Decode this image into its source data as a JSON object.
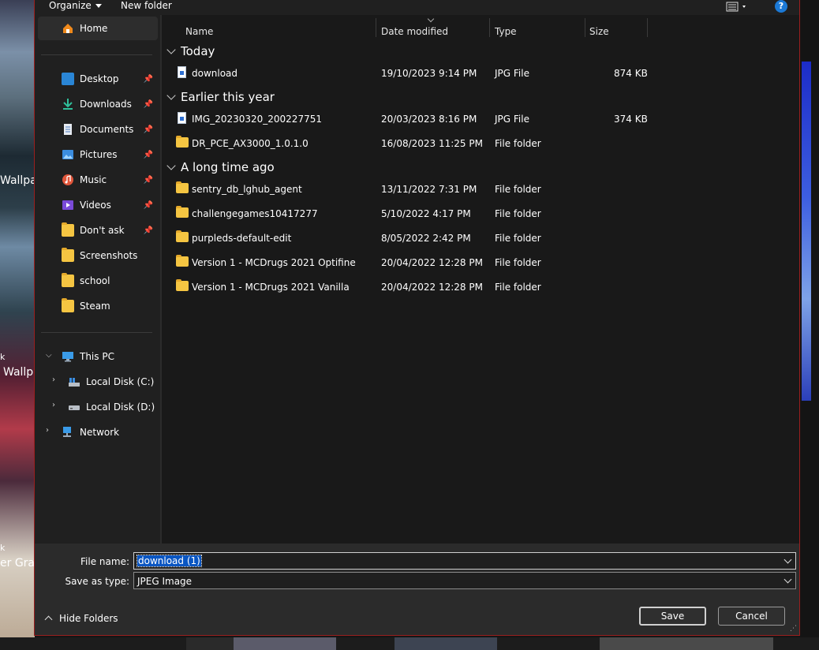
{
  "background": {
    "left_texts": [
      "Wallpap",
      "k",
      "Wallpa",
      "k",
      "er Grap"
    ]
  },
  "toolbar": {
    "organize": "Organize",
    "new_folder": "New folder",
    "help": "?"
  },
  "nav": {
    "home": "Home",
    "quick": [
      {
        "label": "Desktop",
        "pinned": true
      },
      {
        "label": "Downloads",
        "pinned": true
      },
      {
        "label": "Documents",
        "pinned": true
      },
      {
        "label": "Pictures",
        "pinned": true
      },
      {
        "label": "Music",
        "pinned": true
      },
      {
        "label": "Videos",
        "pinned": true
      },
      {
        "label": "Don't ask",
        "pinned": true
      },
      {
        "label": "Screenshots",
        "pinned": false
      },
      {
        "label": "school",
        "pinned": false
      },
      {
        "label": "Steam",
        "pinned": false
      }
    ],
    "this_pc": "This PC",
    "drive_c": "Local Disk (C:)",
    "drive_d": "Local Disk (D:)",
    "network": "Network"
  },
  "columns": {
    "name": "Name",
    "date": "Date modified",
    "type": "Type",
    "size": "Size"
  },
  "groups": [
    {
      "title": "Today",
      "rows": [
        {
          "name": "download",
          "date": "19/10/2023 9:14 PM",
          "type": "JPG File",
          "size": "874 KB",
          "kind": "jpg"
        }
      ]
    },
    {
      "title": "Earlier this year",
      "rows": [
        {
          "name": "IMG_20230320_200227751",
          "date": "20/03/2023 8:16 PM",
          "type": "JPG File",
          "size": "374 KB",
          "kind": "jpg"
        },
        {
          "name": "DR_PCE_AX3000_1.0.1.0",
          "date": "16/08/2023 11:25 PM",
          "type": "File folder",
          "size": "",
          "kind": "folder"
        }
      ]
    },
    {
      "title": "A long time ago",
      "rows": [
        {
          "name": "sentry_db_lghub_agent",
          "date": "13/11/2022 7:31 PM",
          "type": "File folder",
          "size": "",
          "kind": "folder"
        },
        {
          "name": "challengegames10417277",
          "date": "5/10/2022 4:17 PM",
          "type": "File folder",
          "size": "",
          "kind": "folder"
        },
        {
          "name": "purpleds-default-edit",
          "date": "8/05/2022 2:42 PM",
          "type": "File folder",
          "size": "",
          "kind": "folder"
        },
        {
          "name": "Version 1 - MCDrugs 2021 Optifine",
          "date": "20/04/2022 12:28 PM",
          "type": "File folder",
          "size": "",
          "kind": "folder"
        },
        {
          "name": "Version 1 - MCDrugs 2021 Vanilla",
          "date": "20/04/2022 12:28 PM",
          "type": "File folder",
          "size": "",
          "kind": "folder"
        }
      ]
    }
  ],
  "bottom": {
    "file_name_label": "File name:",
    "file_name_value": "download (1)",
    "save_type_label": "Save as type:",
    "save_type_value": "JPEG Image",
    "hide_folders": "Hide Folders",
    "save": "Save",
    "cancel": "Cancel"
  },
  "colors": {
    "accent_border": "#9a1f1f",
    "selection": "#0a56c2",
    "folder": "#f5c542"
  }
}
